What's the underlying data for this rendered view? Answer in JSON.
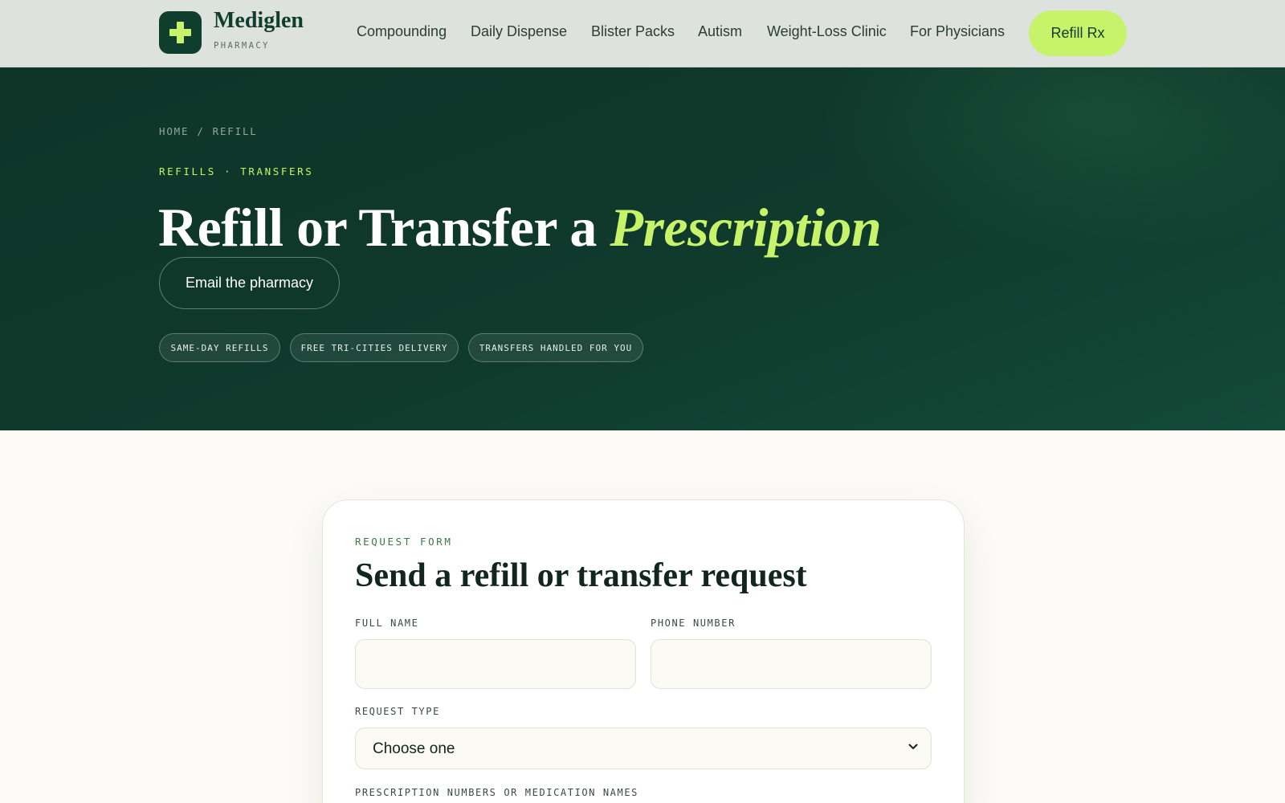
{
  "brand": {
    "name": "Mediglen",
    "subtitle": "PHARMACY"
  },
  "nav": {
    "items": [
      {
        "label": "Compounding"
      },
      {
        "label": "Daily Dispense"
      },
      {
        "label": "Blister Packs"
      },
      {
        "label": "Autism"
      },
      {
        "label": "Weight-Loss Clinic"
      },
      {
        "label": "For Physicians"
      }
    ],
    "cta_label": "Refill Rx"
  },
  "hero": {
    "breadcrumb": {
      "home": "HOME",
      "separator": "/",
      "current": "REFILL"
    },
    "eyebrow": "REFILLS · TRANSFERS",
    "title_main": "Refill or Transfer a ",
    "title_accent": "Prescription",
    "email_button": "Email the pharmacy",
    "pills": [
      {
        "label": "SAME-DAY REFILLS"
      },
      {
        "label": "FREE TRI-CITIES DELIVERY"
      },
      {
        "label": "TRANSFERS HANDLED FOR YOU"
      }
    ]
  },
  "form": {
    "eyebrow": "REQUEST FORM",
    "title": "Send a refill or transfer request",
    "full_name": {
      "label": "FULL NAME",
      "value": "",
      "placeholder": ""
    },
    "phone": {
      "label": "PHONE NUMBER",
      "value": "",
      "placeholder": ""
    },
    "request_type": {
      "label": "REQUEST TYPE",
      "selected": "Choose one"
    },
    "prescriptions": {
      "label": "PRESCRIPTION NUMBERS OR MEDICATION NAMES"
    }
  },
  "colors": {
    "accent": "#c6f36a",
    "brand_dark": "#0f3d2e",
    "header_bg": "#dde2de",
    "page_bg": "#fcfbf7"
  },
  "icons": {
    "logo": "plus-cross-icon",
    "select": "chevron-down-icon"
  }
}
